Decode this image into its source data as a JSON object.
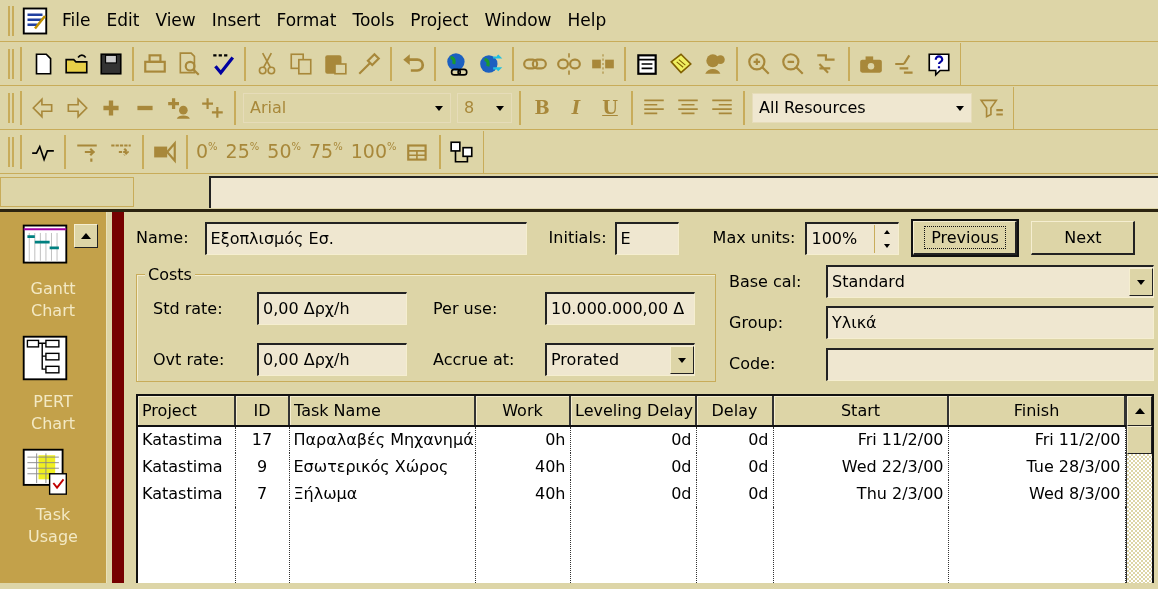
{
  "menu_bar": {
    "items": [
      "File",
      "Edit",
      "View",
      "Insert",
      "Format",
      "Tools",
      "Project",
      "Window",
      "Help"
    ]
  },
  "toolbars": [
    [
      [
        {
          "kind": "new",
          "disabled": false
        },
        {
          "kind": "open",
          "disabled": false
        },
        {
          "kind": "save",
          "disabled": false
        }
      ],
      [
        {
          "kind": "print",
          "disabled": true
        },
        {
          "kind": "preview",
          "disabled": true
        },
        {
          "kind": "spelling",
          "disabled": false
        }
      ],
      [
        {
          "kind": "cut",
          "disabled": true
        },
        {
          "kind": "copy",
          "disabled": true
        },
        {
          "kind": "paste",
          "disabled": true
        },
        {
          "kind": "painter",
          "disabled": true
        }
      ],
      [
        {
          "kind": "undo",
          "disabled": true
        }
      ],
      [
        {
          "kind": "globe-link",
          "disabled": false
        },
        {
          "kind": "globe-arrow",
          "disabled": false
        }
      ],
      [
        {
          "kind": "link",
          "disabled": true
        },
        {
          "kind": "unlink",
          "disabled": true
        },
        {
          "kind": "split",
          "disabled": true
        }
      ],
      [
        {
          "kind": "task-info",
          "disabled": false
        },
        {
          "kind": "note",
          "disabled": false
        },
        {
          "kind": "assign",
          "disabled": true
        }
      ],
      [
        {
          "kind": "zoom-in",
          "disabled": true
        },
        {
          "kind": "zoom-out",
          "disabled": true
        },
        {
          "kind": "goto",
          "disabled": true
        }
      ],
      [
        {
          "kind": "camera",
          "disabled": true
        },
        {
          "kind": "wand",
          "disabled": true
        },
        {
          "kind": "help",
          "disabled": false
        }
      ]
    ],
    [
      [
        {
          "kind": "back",
          "disabled": true
        },
        {
          "kind": "forward",
          "disabled": true
        },
        {
          "kind": "plus",
          "disabled": true
        },
        {
          "kind": "minus",
          "disabled": true
        },
        {
          "kind": "add-person",
          "disabled": true
        },
        {
          "kind": "plus-plus",
          "disabled": true
        }
      ],
      [
        {
          "kind": "combo",
          "value": "Arial",
          "disabled": true
        },
        {
          "kind": "combo",
          "value": "8",
          "disabled": true
        }
      ],
      [
        {
          "kind": "bold",
          "label": "B",
          "disabled": true
        },
        {
          "kind": "italic",
          "label": "I",
          "disabled": true
        },
        {
          "kind": "underline",
          "label": "U",
          "disabled": true
        }
      ],
      [
        {
          "kind": "align-left",
          "disabled": true
        },
        {
          "kind": "align-center",
          "disabled": true
        },
        {
          "kind": "align-right",
          "disabled": true
        }
      ],
      [
        {
          "kind": "combo",
          "value": "All Resources",
          "disabled": false
        },
        {
          "kind": "filter",
          "disabled": true
        }
      ]
    ],
    [
      [
        {
          "kind": "wave",
          "disabled": false
        }
      ],
      [
        {
          "kind": "indent",
          "disabled": true
        },
        {
          "kind": "outdent",
          "disabled": true
        }
      ],
      [
        {
          "kind": "film",
          "disabled": true
        }
      ],
      [
        {
          "kind": "percent",
          "label": "0$^{%}$",
          "disabled": true
        },
        {
          "kind": "percent",
          "label": "25$^{%}$",
          "disabled": true
        },
        {
          "kind": "percent",
          "label": "50$^{%}$",
          "disabled": true
        },
        {
          "kind": "percent",
          "label": "75$^{%}$",
          "disabled": true
        },
        {
          "kind": "percent",
          "label": "100$^{%}$",
          "disabled": true
        },
        {
          "kind": "update",
          "disabled": true
        }
      ],
      [
        {
          "kind": "resource-group",
          "disabled": false
        }
      ]
    ]
  ],
  "view_bar": {
    "items": [
      {
        "label": "Gantt Chart",
        "kind": "gantt"
      },
      {
        "label": "PERT Chart",
        "kind": "pert"
      },
      {
        "label": "Task Usage",
        "kind": "usage"
      }
    ]
  },
  "resource_form": {
    "name_label": "Name:",
    "name": "Εξοπλισμός Εσ.",
    "initials_label": "Initials:",
    "initials": "E",
    "max_units_label": "Max units:",
    "max_units": "100%",
    "buttons": [
      {
        "label": "Previous",
        "focused": true
      },
      {
        "label": "Next",
        "focused": false
      }
    ],
    "costs": {
      "legend": "Costs",
      "std_rate_label": "Std rate:",
      "std_rate": "0,00 Δρχ/h",
      "per_use_label": "Per use:",
      "per_use": "10.000.000,00 Δ",
      "ovt_rate_label": "Ovt rate:",
      "ovt_rate": "0,00 Δρχ/h",
      "accrue_label": "Accrue at:",
      "accrue": "Prorated"
    },
    "base_cal_label": "Base cal:",
    "base_cal": "Standard",
    "group_label": "Group:",
    "group": "Υλικά",
    "code_label": "Code:"
  },
  "table": {
    "columns": [
      "Project",
      "ID",
      "Task Name",
      "Work",
      "Leveling Delay",
      "Delay",
      "Start",
      "Finish"
    ],
    "rows": [
      [
        "Katastima",
        "17",
        "Παραλαβές Μηχανημά",
        "0h",
        "0d",
        "0d",
        "Fri 11/2/00",
        "Fri 11/2/00"
      ],
      [
        "Katastima",
        "9",
        "Εσωτερικός Χώρος",
        "40h",
        "0d",
        "0d",
        "Wed 22/3/00",
        "Tue 28/3/00"
      ],
      [
        "Katastima",
        "7",
        "Ξήλωμα",
        "40h",
        "0d",
        "0d",
        "Thu 2/3/00",
        "Wed 8/3/00"
      ]
    ]
  }
}
